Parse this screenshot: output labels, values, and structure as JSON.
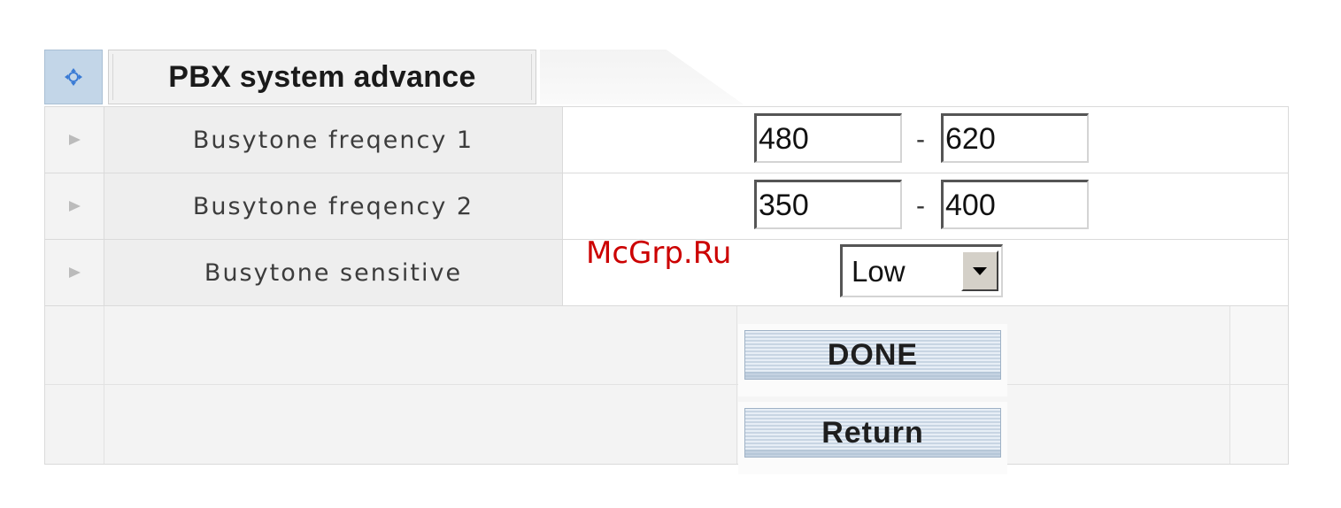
{
  "header": {
    "title": "PBX system advance",
    "icon": "expand-arrows-icon"
  },
  "rows": [
    {
      "label": "Busytone freqency 1",
      "from": "480",
      "to": "620",
      "separator": "-"
    },
    {
      "label": "Busytone freqency 2",
      "from": "350",
      "to": "400",
      "separator": "-"
    },
    {
      "label": "Busytone sensitive",
      "select_value": "Low"
    }
  ],
  "buttons": {
    "done": "DONE",
    "return": "Return"
  },
  "watermark": "McGrp.Ru"
}
